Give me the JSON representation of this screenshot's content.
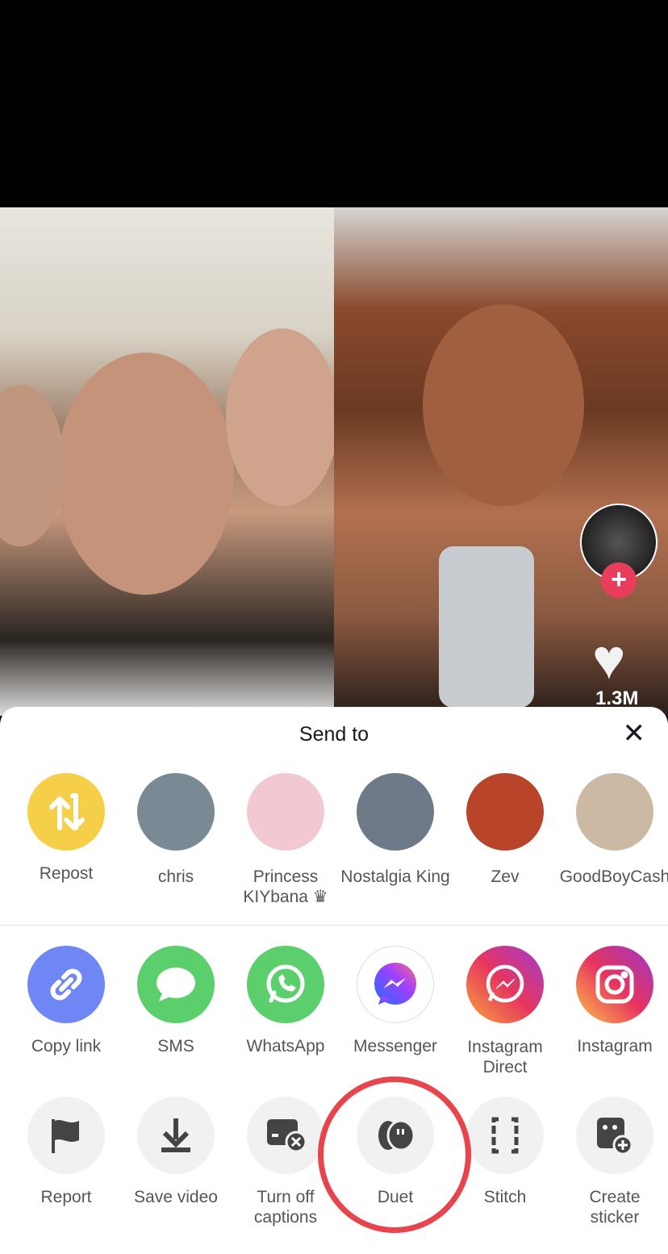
{
  "video": {
    "likes": "1.3M"
  },
  "sheet": {
    "title": "Send to",
    "close_icon": "close-icon"
  },
  "contacts": [
    {
      "label": "Repost",
      "icon": "repost-icon",
      "color": "#f4cf47"
    },
    {
      "label": "chris",
      "color": "#7a8a95"
    },
    {
      "label": "Princess KIYbana ♛",
      "color": "#f2c9d2"
    },
    {
      "label": "Nostalgia King",
      "color": "#6f7a88"
    },
    {
      "label": "Zev",
      "color": "#b8452a"
    },
    {
      "label": "GoodBoyCash",
      "color": "#cbb9a4"
    }
  ],
  "share_apps": [
    {
      "label": "Copy link",
      "icon": "link-icon",
      "color": "#6f87f4"
    },
    {
      "label": "SMS",
      "icon": "chat-bubble-icon",
      "color": "#5ccf6d"
    },
    {
      "label": "WhatsApp",
      "icon": "whatsapp-icon",
      "color": "#5ccf6d"
    },
    {
      "label": "Messenger",
      "icon": "messenger-icon",
      "color": "#ffffff"
    },
    {
      "label": "Instagram Direct",
      "icon": "instagram-direct-icon",
      "color": "#d6336c"
    },
    {
      "label": "Instagram",
      "icon": "instagram-icon",
      "color": "#c13584"
    }
  ],
  "actions": [
    {
      "label": "Report",
      "icon": "flag-icon"
    },
    {
      "label": "Save video",
      "icon": "download-icon"
    },
    {
      "label": "Turn off captions",
      "icon": "captions-off-icon"
    },
    {
      "label": "Duet",
      "icon": "duet-icon"
    },
    {
      "label": "Stitch",
      "icon": "stitch-icon"
    },
    {
      "label": "Create sticker",
      "icon": "sticker-add-icon"
    }
  ],
  "highlight_color": "#e8444c"
}
